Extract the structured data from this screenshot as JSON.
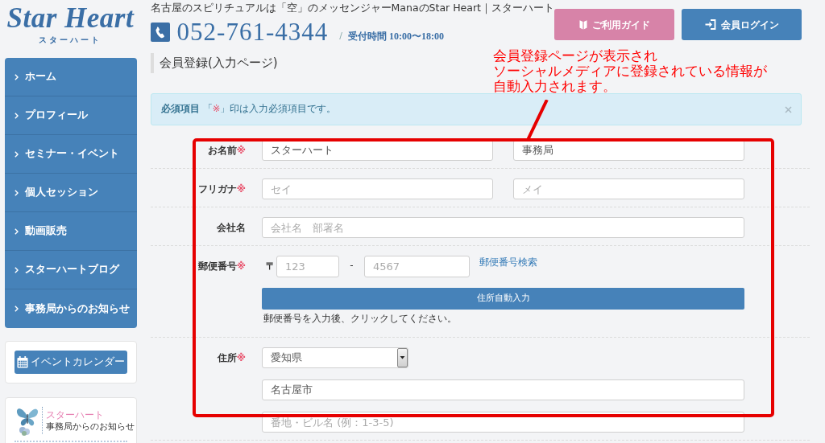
{
  "header": {
    "logo": {
      "title": "Star Heart",
      "subtitle": "スターハート"
    },
    "tagline": "名古屋のスピリチュアルは「空」のメッセンジャーManaのStar Heart｜スターハート",
    "phone": "052-761-4344",
    "separator": "/",
    "hours": "受付時間 10:00〜18:00",
    "buttons": [
      {
        "label": "ご利用ガイド",
        "kind": "guide"
      },
      {
        "label": "会員ログイン",
        "kind": "login"
      }
    ]
  },
  "sidebar": {
    "nav": [
      {
        "label": "ホーム"
      },
      {
        "label": "プロフィール"
      },
      {
        "label": "セミナー・イベント"
      },
      {
        "label": "個人セッション"
      },
      {
        "label": "動画販売"
      },
      {
        "label": "スターハートブログ"
      },
      {
        "label": "事務局からのお知らせ"
      }
    ],
    "calendar_button": "イベントカレンダー",
    "news_banner": {
      "title": "スターハート",
      "subtitle": "事務局からのお知らせ"
    }
  },
  "main": {
    "title": "会員登録(入力ページ)",
    "alert": {
      "label": "必須項目",
      "before": "「",
      "mark": "※",
      "after": "」印は入力必須項目です。"
    },
    "form": {
      "rows": [
        {
          "kind": "pair",
          "label": "お名前",
          "required_mark": "※",
          "fields": [
            {
              "value": "スターハート"
            },
            {
              "value": "事務局"
            }
          ]
        },
        {
          "kind": "pair",
          "label": "フリガナ",
          "required_mark": "※",
          "fields": [
            {
              "placeholder": "セイ"
            },
            {
              "placeholder": "メイ"
            }
          ]
        },
        {
          "kind": "single",
          "label": "会社名",
          "fields": [
            {
              "placeholder": "会社名　部署名"
            }
          ]
        },
        {
          "kind": "postal",
          "label": "郵便番号",
          "required_mark": "※",
          "prefix": "〒",
          "separator": "-",
          "fields": [
            {
              "placeholder": "123"
            },
            {
              "placeholder": "4567"
            }
          ],
          "link": "郵便番号検索",
          "button": "住所自動入力",
          "hint": "郵便番号を入力後、クリックしてください。"
        },
        {
          "kind": "address",
          "label": "住所",
          "required_mark": "※",
          "select": {
            "value": "愛知県"
          },
          "fields": [
            {
              "value": "名古屋市"
            },
            {
              "placeholder": "番地・ビル名 (例：1-3-5)"
            }
          ]
        }
      ]
    }
  },
  "annotation": {
    "lines": [
      "会員登録ページが表示され",
      "ソーシャルメディアに登録されている情報が",
      "自動入力されます。"
    ]
  }
}
